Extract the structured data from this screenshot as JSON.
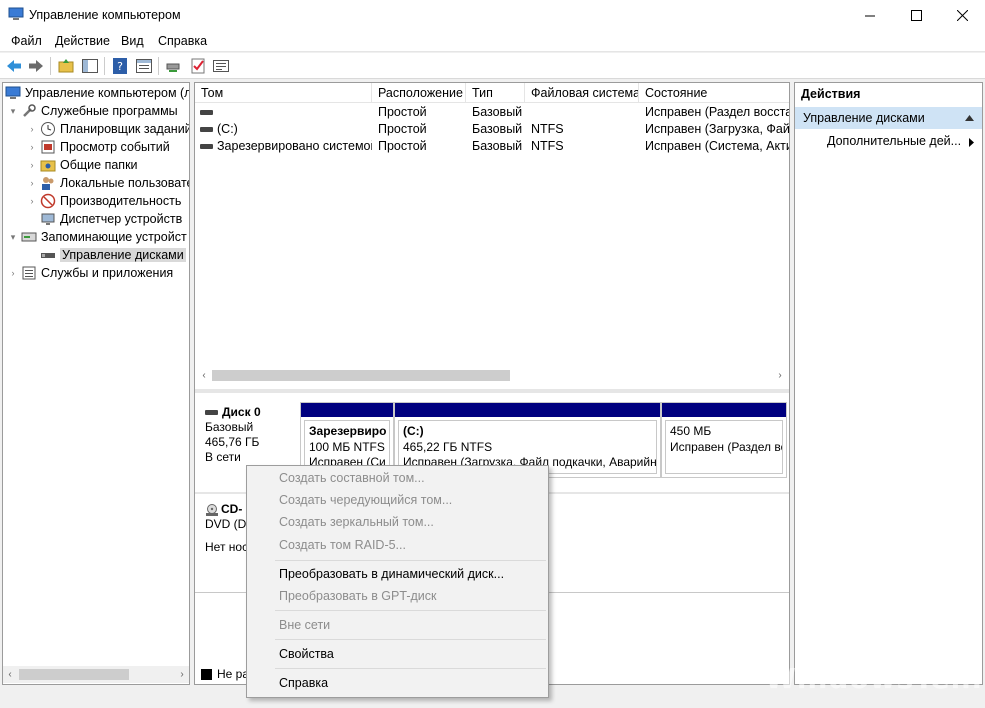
{
  "window": {
    "title": "Управление компьютером",
    "controls": [
      "minimize-icon",
      "maximize-icon",
      "close-icon"
    ]
  },
  "menu": [
    "Файл",
    "Действие",
    "Вид",
    "Справка"
  ],
  "toolbar": [
    "back-arrow-icon",
    "forward-arrow-icon",
    "up-folder-icon",
    "show-hide-tree-icon",
    "help-icon",
    "properties-icon",
    "connect-icon",
    "checklist-icon",
    "list-icon"
  ],
  "tree": {
    "root": "Управление компьютером (л",
    "system_tools": "Служебные программы",
    "task_scheduler": "Планировщик заданий",
    "event_viewer": "Просмотр событий",
    "shared_folders": "Общие папки",
    "local_users": "Локальные пользовате",
    "performance": "Производительность",
    "device_manager": "Диспетчер устройств",
    "storage": "Запоминающие устройст",
    "disk_management": "Управление дисками",
    "services": "Службы и приложения"
  },
  "list": {
    "columns": [
      "Том",
      "Расположение",
      "Тип",
      "Файловая система",
      "Состояние"
    ],
    "rows": [
      [
        "",
        "Простой",
        "Базовый",
        "",
        "Исправен (Раздел восстан"
      ],
      [
        "(C:)",
        "Простой",
        "Базовый",
        "NTFS",
        "Исправен (Загрузка, Файл"
      ],
      [
        "Зарезервировано системой",
        "Простой",
        "Базовый",
        "NTFS",
        "Исправен (Система, Актив"
      ]
    ]
  },
  "disk0": {
    "name": "Диск 0",
    "type": "Базовый",
    "size": "465,76 ГБ",
    "status": "В сети",
    "partitions": [
      {
        "name": "Зарезервиро",
        "size": "100 МБ NTFS",
        "status": "Исправен (Си"
      },
      {
        "name": "(C:)",
        "size": "465,22 ГБ NTFS",
        "status": "Исправен (Загрузка, Файл подкачки, Аварийн"
      },
      {
        "name": "",
        "size": "450 МБ",
        "status": "Исправен (Раздел во"
      }
    ]
  },
  "cd": {
    "name": "CD-",
    "type": "DVD (D:",
    "status": "Нет нос"
  },
  "legend": {
    "unallocated": "Не ра"
  },
  "actions": {
    "header": "Действия",
    "section": "Управление дисками",
    "more": "Дополнительные дей..."
  },
  "context_menu": {
    "items": [
      {
        "label": "Создать составной том...",
        "enabled": false
      },
      {
        "label": "Создать чередующийся том...",
        "enabled": false
      },
      {
        "label": "Создать зеркальный том...",
        "enabled": false
      },
      {
        "label": "Создать том RAID-5...",
        "enabled": false
      },
      {
        "label": "Преобразовать в динамический диск...",
        "enabled": true
      },
      {
        "label": "Преобразовать в GPT-диск",
        "enabled": false
      },
      {
        "label": "Вне сети",
        "enabled": false
      },
      {
        "label": "Свойства",
        "enabled": true
      },
      {
        "label": "Справка",
        "enabled": true
      }
    ]
  },
  "colors": {
    "partition_bar": "#00007f",
    "selection": "#cfe3f5"
  }
}
